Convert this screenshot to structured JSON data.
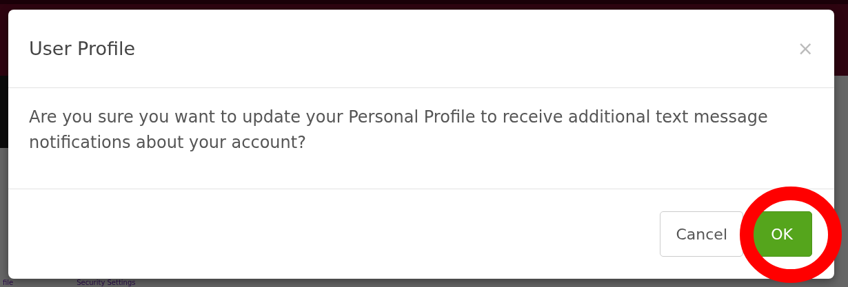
{
  "background": {
    "tabs": [
      {
        "label": "file"
      },
      {
        "label": "Security Settings"
      }
    ]
  },
  "dialog": {
    "title": "User Profile",
    "close": "×",
    "message": "Are you sure you want to update your Personal Profile to receive additional text message notifications about your account?",
    "buttons": [
      {
        "label": "Cancel",
        "kind": "default"
      },
      {
        "label": "OK",
        "kind": "primary"
      }
    ]
  }
}
